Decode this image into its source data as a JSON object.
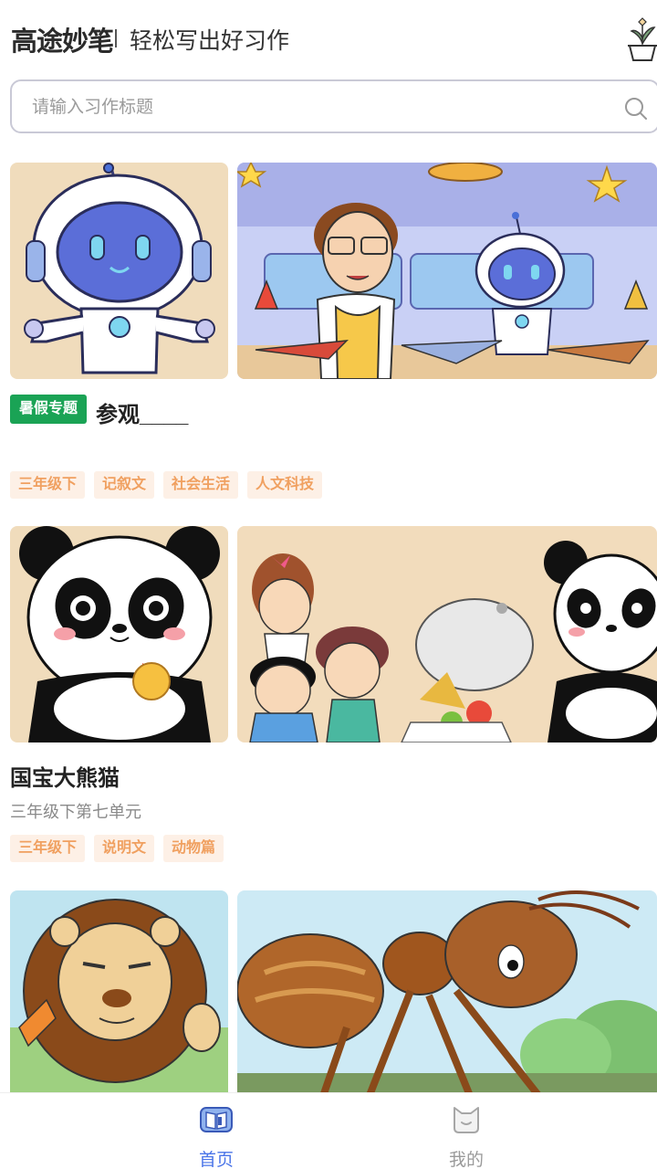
{
  "header": {
    "brand": "高途妙笔",
    "slogan": "轻松写出好习作"
  },
  "search": {
    "placeholder": "请输入习作标题"
  },
  "cards": [
    {
      "badge": "暑假专题",
      "title": "参观____",
      "subtitle": "",
      "tags": [
        "三年级下",
        "记叙文",
        "社会生活",
        "人文科技"
      ]
    },
    {
      "badge": "",
      "title": "国宝大熊猫",
      "subtitle": "三年级下第七单元",
      "tags": [
        "三年级下",
        "说明文",
        "动物篇"
      ]
    }
  ],
  "tabbar": {
    "home": "首页",
    "mine": "我的"
  },
  "colors": {
    "accent": "#4a74e8",
    "badge": "#1aa355",
    "tag_bg": "#fdf0e6",
    "tag_text": "#f0a060"
  },
  "icons": {
    "search": "search-icon",
    "plant": "plant-pot-icon",
    "home": "book-icon",
    "mine": "cat-face-icon"
  }
}
